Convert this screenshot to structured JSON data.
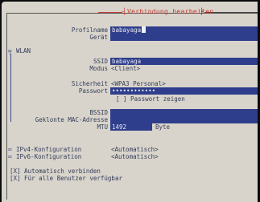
{
  "dialog": {
    "title": "Verbindung bearbeiten"
  },
  "profile": {
    "name_label": "Profilname",
    "name_value": "babayaga",
    "device_label": "Gerät",
    "device_value": ""
  },
  "wlan": {
    "section_marker": "╤",
    "section_label": "WLAN",
    "ssid_label": "SSID",
    "ssid_value": "babayaga",
    "mode_label": "Modus",
    "mode_value": "<Client>",
    "security_label": "Sicherheit",
    "security_value": "<WPA3 Personal>",
    "password_label": "Passwort",
    "password_value": "••••••••••••",
    "show_password": "[ ] Passwort zeigen",
    "bssid_label": "BSSID",
    "bssid_value": "",
    "cloned_mac_label": "Geklonte MAC-Adresse",
    "cloned_mac_value": "",
    "mtu_label": "MTU",
    "mtu_value": "1492",
    "mtu_unit": "Byte"
  },
  "ipv4": {
    "marker": "═",
    "label": "IPv4-Konfiguration",
    "value": "<Automatisch>"
  },
  "ipv6": {
    "marker": "═",
    "label": "IPv6-Konfiguration",
    "value": "<Automatisch>"
  },
  "options": {
    "autoconnect": "[X] Automatisch verbinden",
    "all_users": "[X] Für alle Benutzer verfügbar"
  },
  "colors": {
    "background": "#d8d4cb",
    "field": "#2e3e8c",
    "label_text": "#343c5a",
    "title_accent": "#c53a30"
  }
}
